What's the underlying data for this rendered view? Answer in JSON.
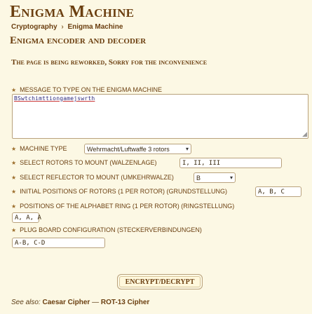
{
  "site": {
    "title": "Enigma Machine"
  },
  "breadcrumb": {
    "items": [
      "Cryptography",
      "Enigma Machine"
    ],
    "separator": "›"
  },
  "page": {
    "title": "Enigma encoder and decoder"
  },
  "notice": "The page is being reworked, Sorry for the inconvenience",
  "form": {
    "message_label": "Message to type on the Enigma machine",
    "message_value": "BSwtchimttiongamejswrth",
    "machine_type_label": "Machine type",
    "machine_type_value": "Wehrmacht/Luftwaffe 3 rotors",
    "rotors_label": "Select rotors to mount (Walzenlage)",
    "rotors_value": "I, II, III",
    "reflector_label": "Select reflector to mount (Umkehrwalze)",
    "reflector_value": "B",
    "initial_positions_label": "Initial positions of rotors (1 per rotor) (Grundstellung)",
    "initial_positions_value": "A, B, C",
    "ring_positions_label": "Positions of the alphabet ring (1 per rotor) (Ringstellung)",
    "ring_positions_value": "A, A, A",
    "plugboard_label": "Plug board configuration (Steckerverbindungen)",
    "plugboard_value": "A-B, C-D",
    "submit_label": "ENCRYPT/DECRYPT"
  },
  "see_also": {
    "label": "See also:",
    "links": [
      "Caesar Cipher",
      "ROT-13 Cipher"
    ],
    "separator": "—"
  },
  "icons": {
    "bullet": "star-icon",
    "dropdown": "chevron-down-icon",
    "resize": "resize-grip-icon"
  },
  "colors": {
    "background": "#fcf8e4",
    "heading": "#6b3f10",
    "border": "#b9a27c"
  }
}
